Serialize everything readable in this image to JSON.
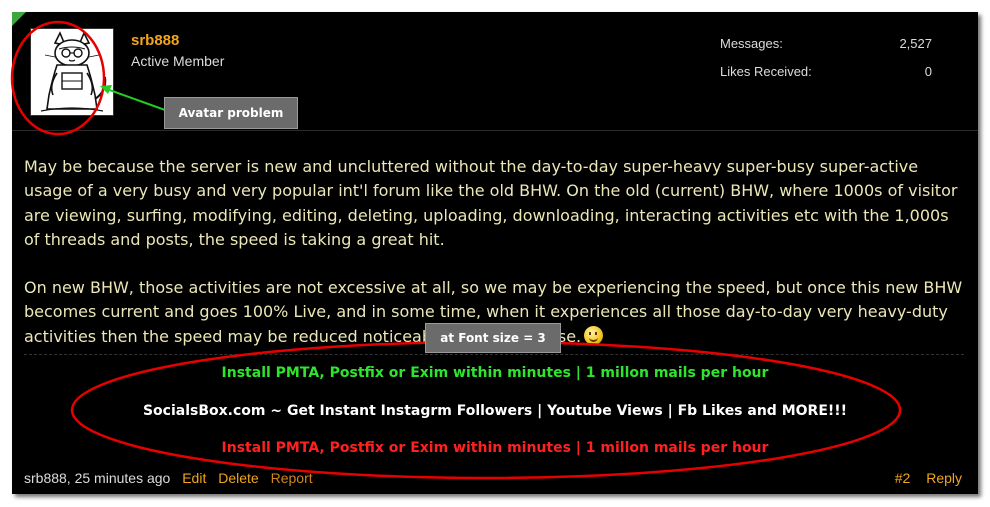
{
  "user": {
    "name": "srb888",
    "title": "Active Member",
    "stats": [
      {
        "label": "Messages:",
        "value": "2,527"
      },
      {
        "label": "Likes Received:",
        "value": "0"
      }
    ]
  },
  "message": {
    "paragraphs": [
      "May be because the server is new and uncluttered without the day-to-day super-heavy super-busy super-active usage of a very busy and very popular int'l forum like the old BHW. On the old (current) BHW, where 1000s of visitor are viewing, surfing, modifying, editing, deleting, uploading, downloading, interacting activities etc with the 1,000s of threads and posts, the speed is taking a great hit.",
      "On new BHW, those activities are not excessive at all, so we may be experiencing the speed, but once this new BHW becomes current and goes 100% Live, and in some time, when it experiences all those day-to-day very heavy-duty activities then the speed may be reduced noticeably. IMHO of course."
    ],
    "smiley": "smiley-icon"
  },
  "signature": {
    "line1": "Install PMTA, Postfix or Exim within minutes | 1 millon mails per hour",
    "line2": "SocialsBox.com ~ Get Instant Instagrm Followers | Youtube Views | Fb Likes and MORE!!!",
    "line3": "Install PMTA, Postfix or Exim within minutes | 1 millon mails per hour"
  },
  "footer": {
    "meta": "srb888, 25 minutes ago",
    "edit": "Edit",
    "delete": "Delete",
    "report": "Report",
    "post_number": "#2",
    "reply": "Reply"
  },
  "annotations": {
    "avatar_callout": "Avatar problem",
    "font_callout": "at Font size = 3"
  },
  "colors": {
    "username": "#f2a51d",
    "message_text": "#ece7b6",
    "sig_green": "#2ee52e",
    "sig_white": "#ffffff",
    "sig_red": "#ff2020",
    "annotation_red": "#e60000",
    "annotation_arrow": "#22cc22"
  }
}
